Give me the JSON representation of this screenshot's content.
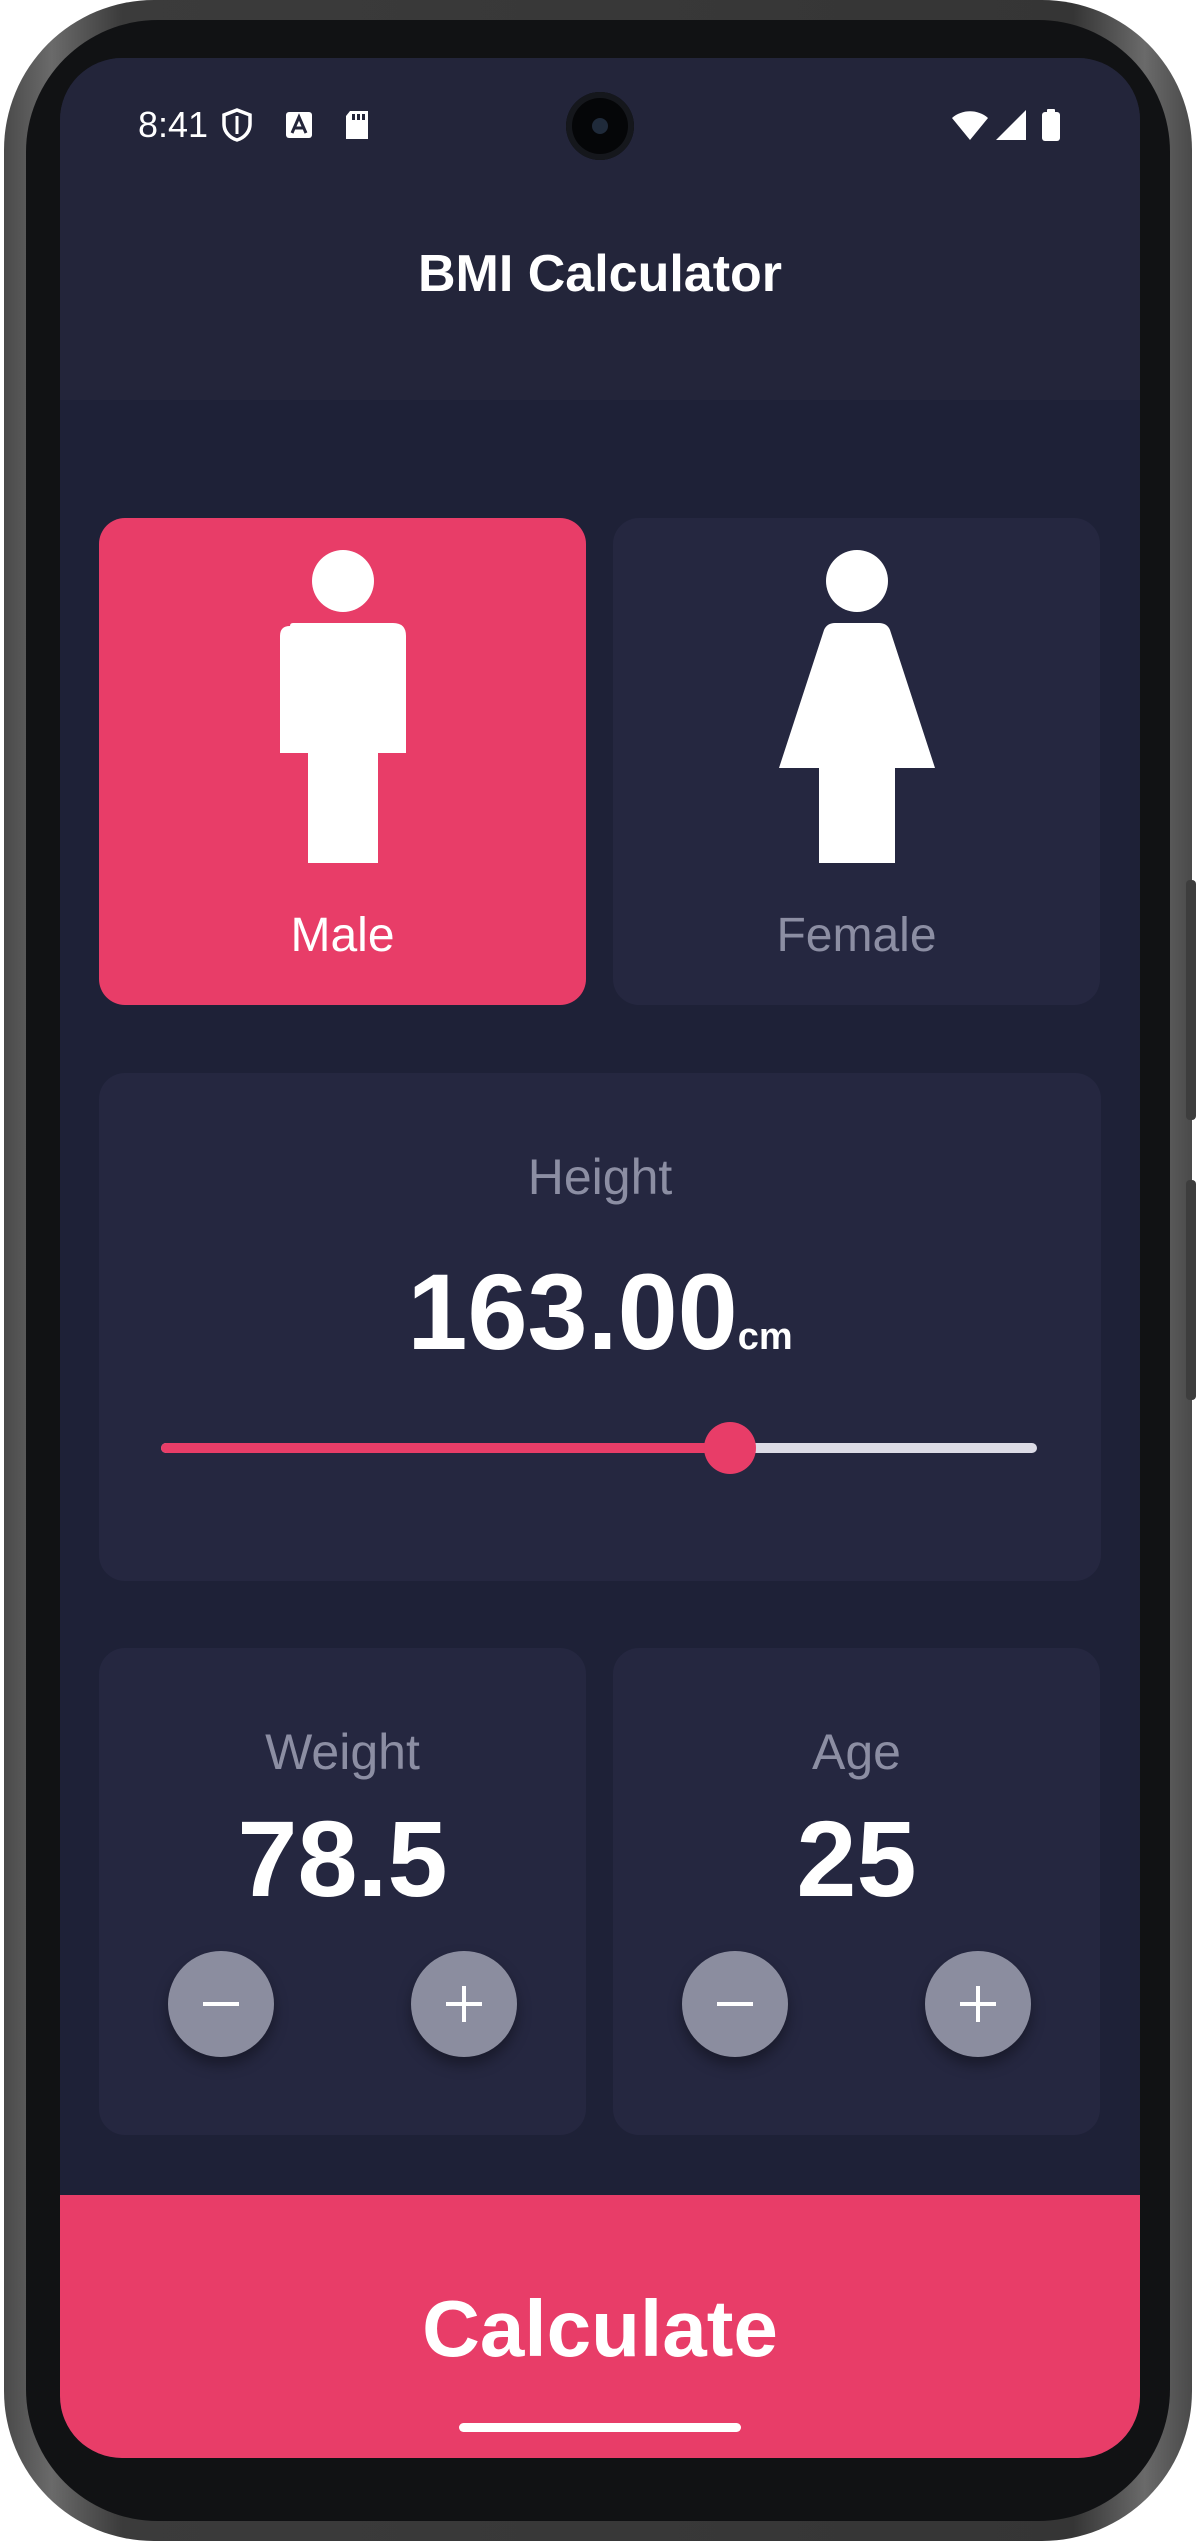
{
  "status_bar": {
    "time": "8:41",
    "left_icons": [
      "shield-icon",
      "a-letter-icon",
      "sd-card-icon"
    ],
    "right_icons": [
      "wifi-icon",
      "cellular-signal-icon",
      "battery-icon"
    ]
  },
  "app_bar": {
    "title": "BMI Calculator"
  },
  "gender": {
    "male_label": "Male",
    "female_label": "Female",
    "selected": "Male"
  },
  "height": {
    "label": "Height",
    "value": "163.00",
    "unit": "cm",
    "slider_fraction": 0.65
  },
  "weight": {
    "label": "Weight",
    "value": "78.5"
  },
  "age": {
    "label": "Age",
    "value": "25"
  },
  "actions": {
    "calculate_label": "Calculate"
  },
  "colors": {
    "accent": "#e83d68",
    "background": "#1e2137",
    "card": "#252740",
    "muted_text": "#8c8ea3",
    "button": "#8b8d9f"
  }
}
